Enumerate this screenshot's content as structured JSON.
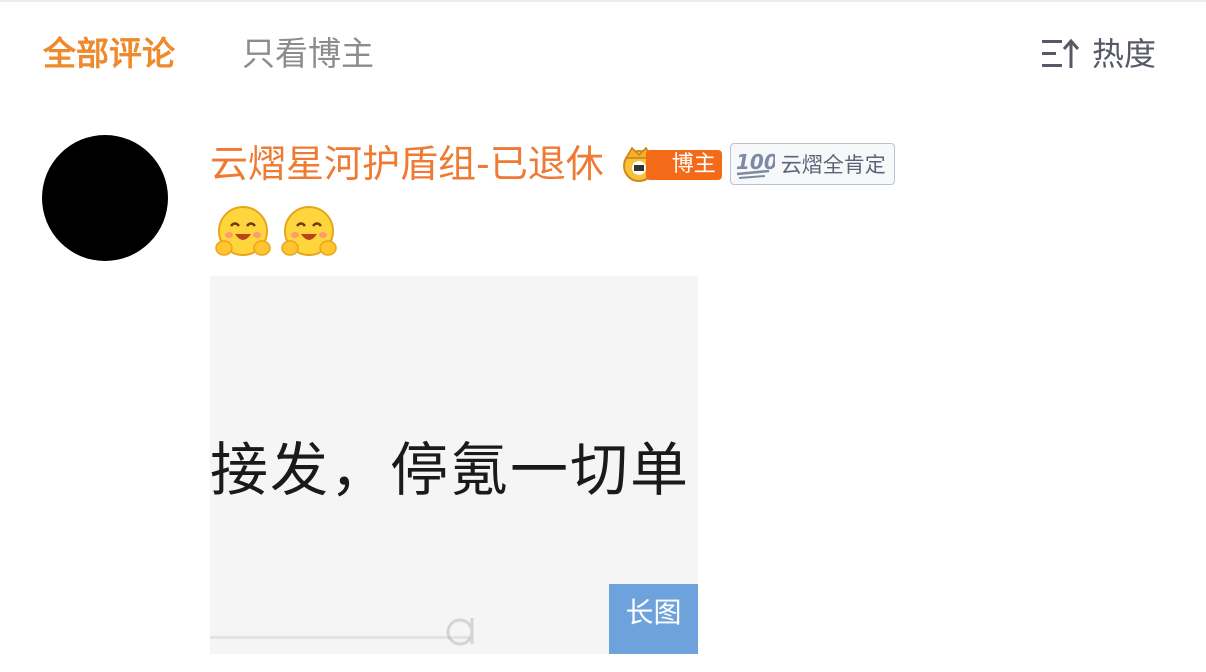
{
  "tabs": {
    "active": "全部评论",
    "inactive": "只看博主"
  },
  "sort": {
    "icon": "sort-icon",
    "label": "热度"
  },
  "comment": {
    "username": "云熠星河护盾组-已退休",
    "blogger_badge": "博主",
    "fan_badge": "云熠全肯定",
    "emoji_icon": "smiling-face-with-open-hands-emoji",
    "image": {
      "text": "接发，停氪一切单",
      "long_image_label": "长图"
    }
  },
  "colors": {
    "accent_orange": "#ef8a2c",
    "username": "#ef7a33",
    "blogger_tag": "#f36a18",
    "long_image_badge": "#6ea2dd",
    "inactive_text": "#8c8c8c"
  }
}
